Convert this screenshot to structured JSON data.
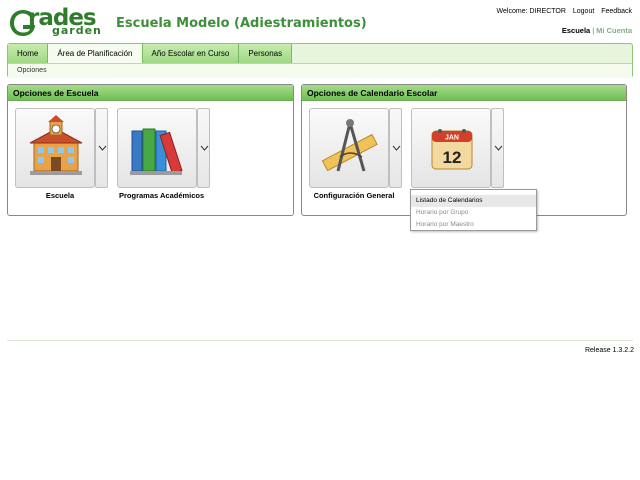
{
  "logo": {
    "text": "rades",
    "sub": "garden",
    "icon": "grades-garden-logo-icon"
  },
  "header": {
    "school_title": "Escuela Modelo (Adiestramientos)",
    "welcome": "Welcome: DIRECTOR",
    "logout": "Logout",
    "feedback": "Feedback",
    "context_active": "Escuela",
    "context_separator": "|",
    "context_inactive": "Mi Cuenta"
  },
  "nav": {
    "tabs": [
      {
        "label": "Home"
      },
      {
        "label": "Área de Planificación"
      },
      {
        "label": "Año Escolar en Curso"
      },
      {
        "label": "Personas"
      }
    ],
    "active_tab": "Área de Planificación",
    "sub_item": "Opciones"
  },
  "panels": {
    "school": {
      "title": "Opciones de Escuela",
      "tiles": [
        {
          "label": "Escuela",
          "icon": "school-building-icon"
        },
        {
          "label": "Programas Académicos",
          "icon": "books-icon"
        }
      ]
    },
    "calendar": {
      "title": "Opciones de Calendario Escolar",
      "tiles": [
        {
          "label": "Configuración General",
          "icon": "ruler-compass-icon"
        },
        {
          "label": "",
          "icon": "calendar-icon",
          "calendar_month": "JAN",
          "calendar_day": "12"
        }
      ]
    }
  },
  "dropdown": {
    "items": [
      {
        "label": "Listado de Calendarios",
        "enabled": true
      },
      {
        "label": "Horario por Grupo",
        "enabled": false
      },
      {
        "label": "Horario por Maestro",
        "enabled": false
      }
    ]
  },
  "footer": {
    "release": "Release 1.3.2.2"
  },
  "colors": {
    "brand_green": "#3e8f3a",
    "nav_bg": "#e6f5dc",
    "panel_head": "#6fbf52"
  }
}
